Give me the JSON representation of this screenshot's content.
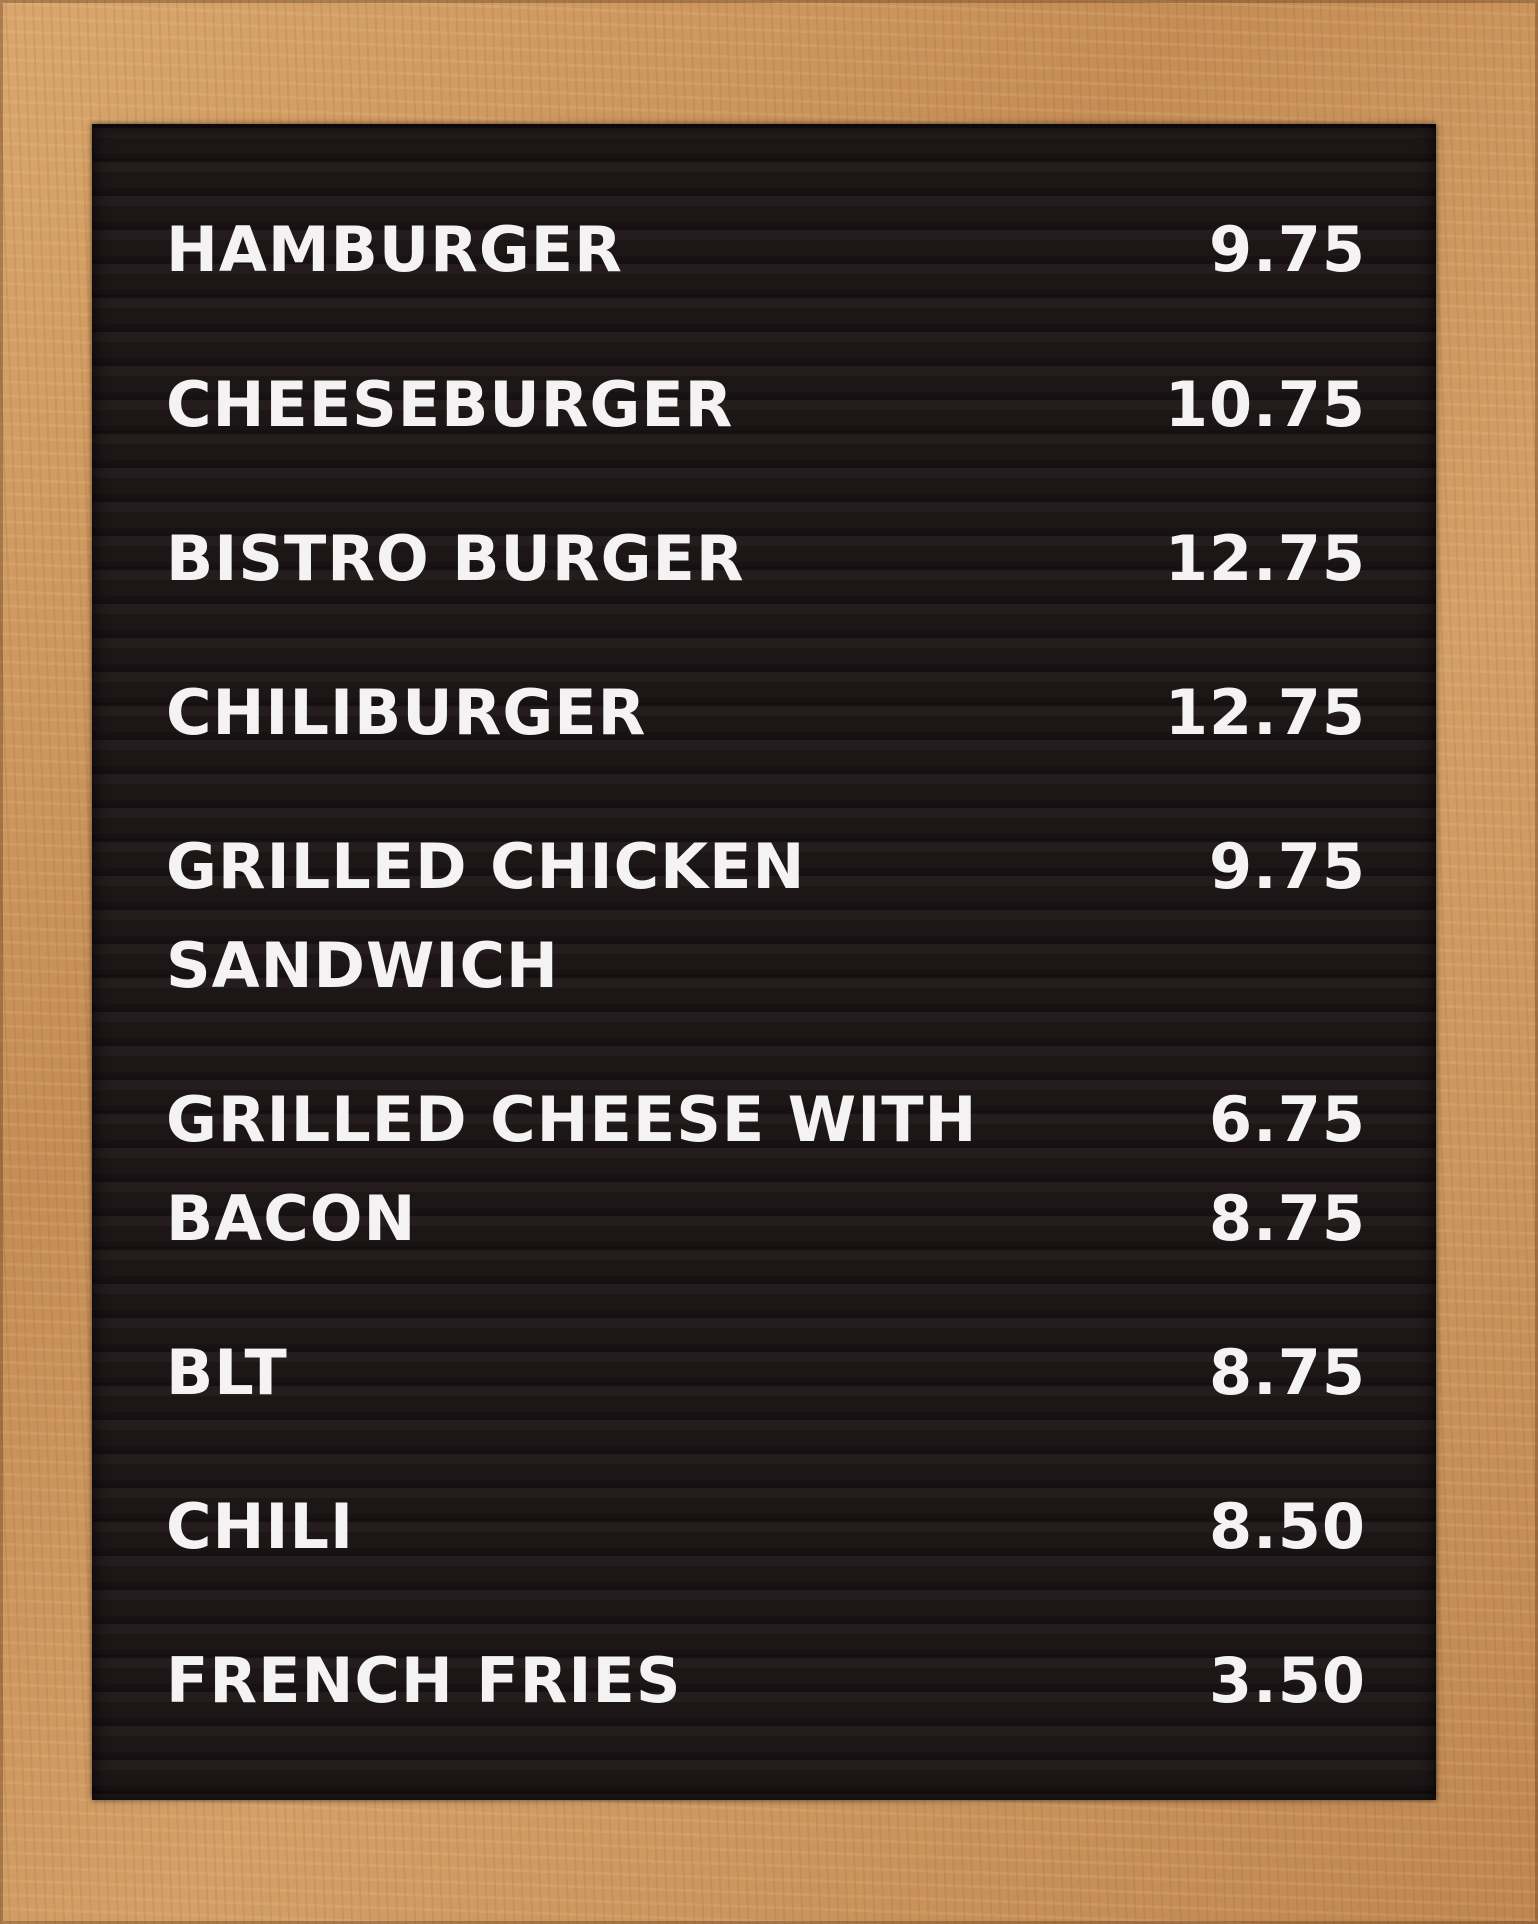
{
  "menu": {
    "items": [
      {
        "name": "HAMBURGER",
        "price": "9.75"
      },
      {
        "name": "CHEESEBURGER",
        "price": "10.75"
      },
      {
        "name": "BISTRO BURGER",
        "price": "12.75"
      },
      {
        "name": "CHILIBURGER",
        "price": "12.75"
      },
      {
        "name_line1": "GRILLED CHICKEN",
        "name_line2": "SANDWICH",
        "price": "9.75"
      },
      {
        "name_line1": "GRILLED CHEESE WITH",
        "name_line2": "BACON",
        "price": "6.75",
        "price_line2": "8.75"
      },
      {
        "name": "BLT",
        "price": "8.75"
      },
      {
        "name": "CHILI",
        "price": "8.50"
      },
      {
        "name": "FRENCH FRIES",
        "price": "3.50"
      }
    ]
  },
  "colors": {
    "frame_wood": "#c9955e",
    "board_felt": "#1c1617",
    "letters": "#f4f2f2"
  }
}
